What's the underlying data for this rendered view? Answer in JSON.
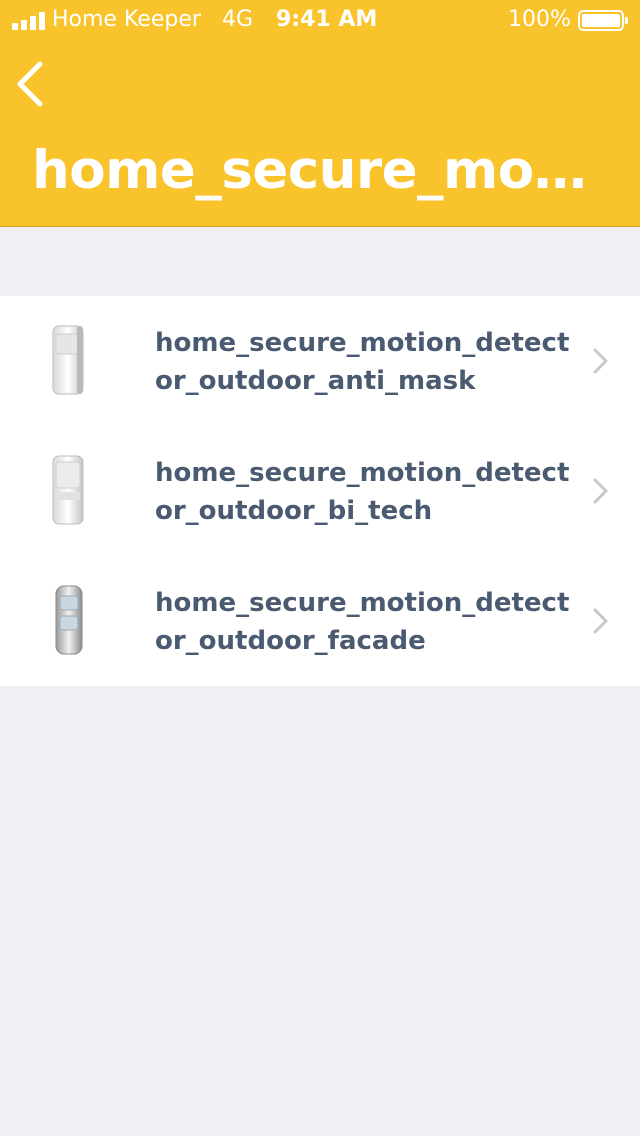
{
  "status_bar": {
    "carrier": "Home Keeper",
    "network": "4G",
    "time": "9:41 AM",
    "battery": "100%"
  },
  "header": {
    "title": "home_secure_moti..."
  },
  "detectors": [
    {
      "label": "home_secure_motion_detector_outdoor_anti_mask",
      "icon": "motion-detector-anti-mask-icon"
    },
    {
      "label": "home_secure_motion_detector_outdoor_bi_tech",
      "icon": "motion-detector-bi-tech-icon"
    },
    {
      "label": "home_secure_motion_detector_outdoor_facade",
      "icon": "motion-detector-facade-icon"
    }
  ],
  "colors": {
    "header": "#f9c32c",
    "background": "#efeff4",
    "label": "#4a5a70",
    "chevron": "#c7c7cc"
  }
}
